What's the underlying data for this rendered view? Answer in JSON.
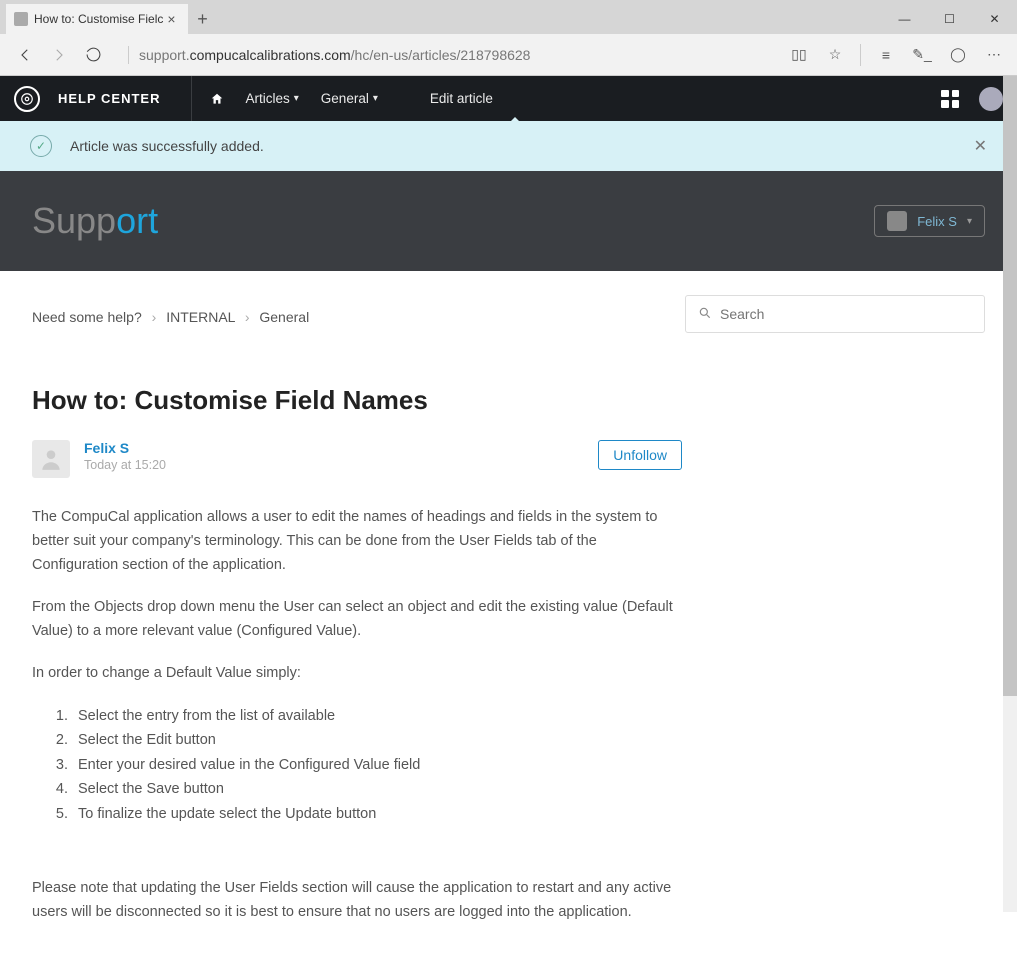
{
  "browser": {
    "tab_title": "How to: Customise Fielc",
    "url_prefix": "support.",
    "url_host": "compucalcalibrations.com",
    "url_path": "/hc/en-us/articles/218798628"
  },
  "admin": {
    "title": "HELP CENTER",
    "nav": {
      "articles": "Articles",
      "general": "General",
      "edit": "Edit article"
    }
  },
  "notice": {
    "text": "Article was successfully added."
  },
  "support": {
    "logo_a": "Supp",
    "logo_b": "ort",
    "user": "Felix S"
  },
  "breadcrumb": {
    "a": "Need some help?",
    "b": "INTERNAL",
    "c": "General"
  },
  "search": {
    "placeholder": "Search"
  },
  "article": {
    "title": "How to: Customise Field Names",
    "author": "Felix S",
    "date": "Today at 15:20",
    "unfollow": "Unfollow",
    "p1": "The CompuCal application allows a user to edit the names of headings and fields in the system to better suit your company's terminology. This can be done from the User Fields tab of the Configuration section of the application.",
    "p2": "From the Objects drop down menu the User can select an object and edit the existing value (Default Value) to a more relevant value (Configured Value).",
    "p3": "In order to change a Default Value simply:",
    "steps": [
      "Select the entry from the list of available",
      "Select the Edit button",
      "Enter your desired value in the Configured Value field",
      "Select the Save button",
      "To finalize the update select the Update button"
    ],
    "p4": "Please note that updating the User Fields section will cause the application to restart and any active users will be disconnected so it is best to ensure that no users are logged into the application."
  }
}
